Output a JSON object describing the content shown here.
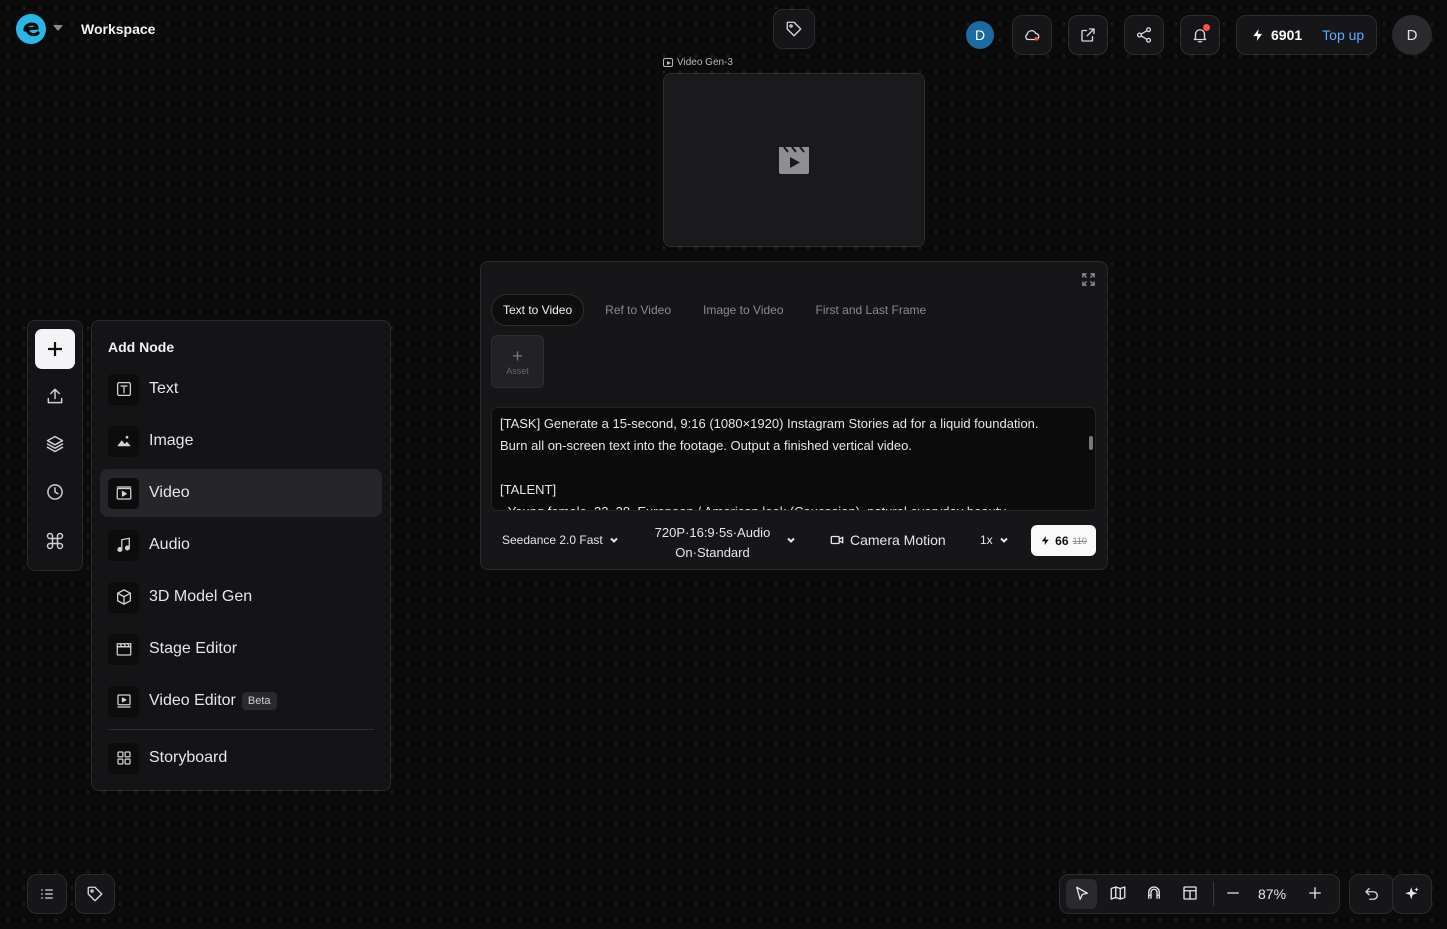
{
  "header": {
    "workspace_title": "Workspace",
    "user_initial": "D",
    "profile_initial": "D",
    "credits": "6901",
    "topup_label": "Top up"
  },
  "video_node": {
    "label": "Video Gen-3"
  },
  "generator": {
    "tabs": [
      {
        "label": "Text to Video",
        "active": true
      },
      {
        "label": "Ref to Video",
        "active": false
      },
      {
        "label": "Image to Video",
        "active": false
      },
      {
        "label": "First and Last Frame",
        "active": false
      }
    ],
    "asset_label": "Asset",
    "prompt": "[TASK] Generate a 15-second, 9:16 (1080×1920) Instagram Stories ad for a liquid foundation.\nBurn all on-screen text into the footage. Output a finished vertical video.\n\n[TALENT]\n- Young female, 22–28, European / American look (Caucasian), natural everyday beauty",
    "model": "Seedance 2.0 Fast",
    "resolution_line1": "720P·16:9·5s·Audio",
    "resolution_line2": "On·Standard",
    "camera_motion": "Camera Motion",
    "speed": "1x",
    "cost": "66",
    "cost_original": "110"
  },
  "add_node": {
    "title": "Add Node",
    "items": [
      {
        "label": "Text",
        "icon": "text-icon"
      },
      {
        "label": "Image",
        "icon": "image-icon"
      },
      {
        "label": "Video",
        "icon": "video-icon",
        "selected": true
      },
      {
        "label": "Audio",
        "icon": "audio-icon"
      },
      {
        "label": "3D Model Gen",
        "icon": "cube-icon"
      },
      {
        "label": "Stage Editor",
        "icon": "clapper-icon"
      },
      {
        "label": "Video Editor",
        "icon": "video-editor-icon",
        "badge": "Beta"
      },
      {
        "label": "Storyboard",
        "icon": "grid-icon"
      }
    ]
  },
  "canvas": {
    "zoom": "87%"
  },
  "colors": {
    "accent": "#5fa8ff",
    "avatar": "#1b6aa0",
    "notification": "#ff4d4d"
  }
}
